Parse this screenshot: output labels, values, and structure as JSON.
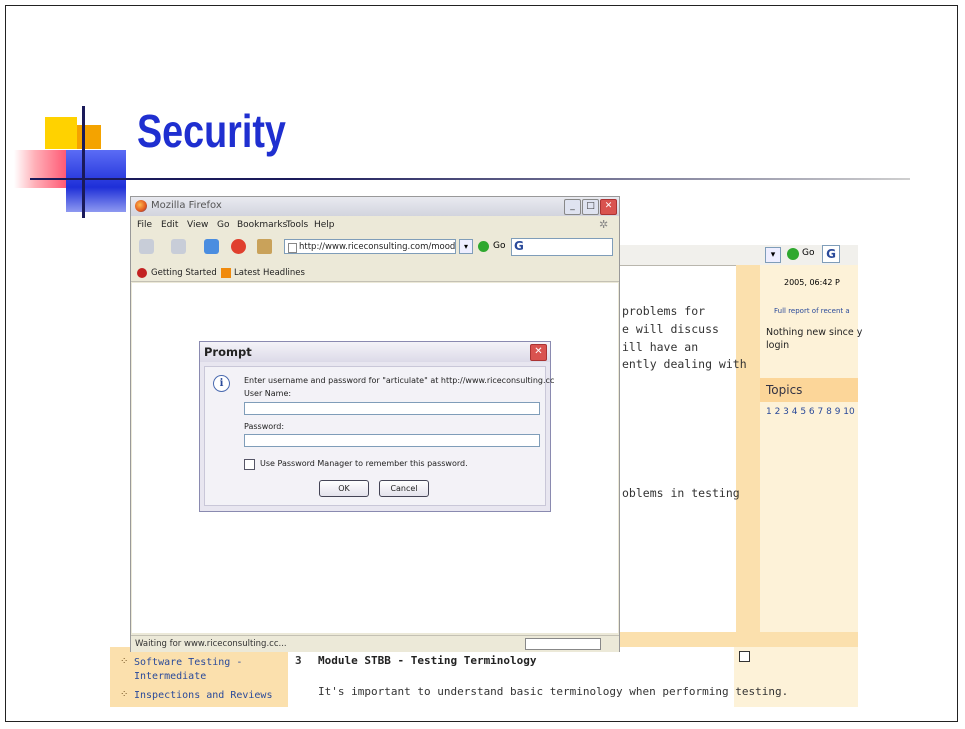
{
  "slide": {
    "title": "Security"
  },
  "colors": {
    "title": "#1f2fd0",
    "accent_yellow": "#ffd200",
    "accent_orange": "#f4a300",
    "accent_blue": "#1e2fd8",
    "moodle_side": "#fbe0ad"
  },
  "firefox": {
    "window_title": "Mozilla Firefox",
    "menu": [
      "File",
      "Edit",
      "View",
      "Go",
      "Bookmarks",
      "Tools",
      "Help"
    ],
    "url": "http://www.riceconsulting.com/moodle/r",
    "go_label": "Go",
    "search_logo": "G",
    "bookmarks": [
      "Getting Started",
      "Latest Headlines"
    ],
    "status": "Waiting for www.riceconsulting.cc..."
  },
  "prompt": {
    "title": "Prompt",
    "message": "Enter username and password for \"articulate\" at http://www.riceconsulting.cc",
    "username_label": "User Name:",
    "username_value": "",
    "password_label": "Password:",
    "password_value": "",
    "remember_label": "Use Password Manager to remember this password.",
    "ok_label": "OK",
    "cancel_label": "Cancel"
  },
  "background_page": {
    "go_label": "Go",
    "search_logo": "G",
    "body_lines": [
      "problems for",
      "e will discuss",
      "ill have an",
      "ently dealing with"
    ],
    "body_line_later": "oblems in testing",
    "side_date": "2005, 06:42 P",
    "side_report": "Full report of recent a",
    "side_nothing": "Nothing new since y",
    "side_login": "login",
    "topics_label": "Topics",
    "topics_numbers": "1 2 3 4 5 6 7 8 9 10",
    "left_links": [
      "Software Testing -",
      "Intermediate",
      "Inspections and Reviews"
    ],
    "module_number": "3",
    "module_title": "Module STBB - Testing Terminology",
    "module_text": "It's important to understand basic terminology when performing testing."
  }
}
